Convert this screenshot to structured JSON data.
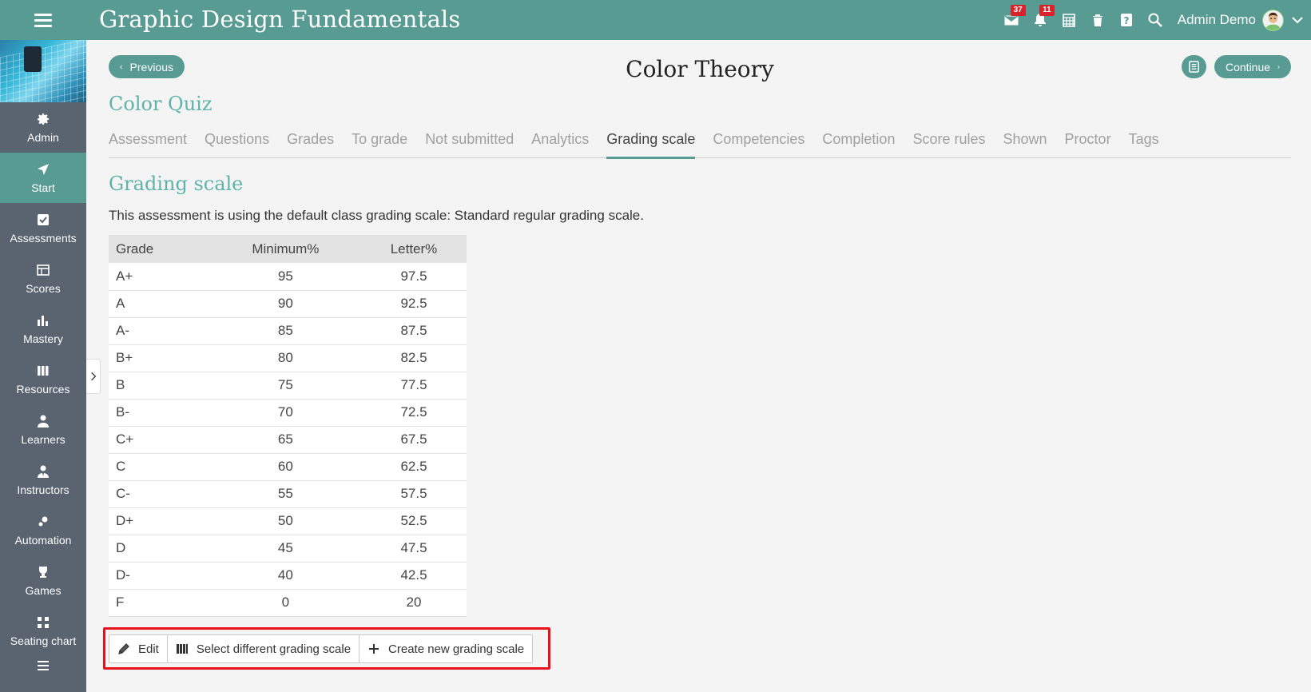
{
  "app": {
    "title": "Graphic Design Fundamentals",
    "accent": "#579b93"
  },
  "topbar": {
    "messages_badge": "37",
    "notifications_badge": "11",
    "user_name": "Admin Demo",
    "icons": [
      "mail-icon",
      "bell-icon",
      "calendar-icon",
      "trash-icon",
      "help-icon",
      "search-icon"
    ]
  },
  "sidebar": {
    "items": [
      {
        "label": "Admin",
        "icon": "gear-icon"
      },
      {
        "label": "Start",
        "icon": "navigate-icon",
        "active": true
      },
      {
        "label": "Assessments",
        "icon": "checkbox-icon"
      },
      {
        "label": "Scores",
        "icon": "table-icon"
      },
      {
        "label": "Mastery",
        "icon": "bar-chart-icon"
      },
      {
        "label": "Resources",
        "icon": "books-icon"
      },
      {
        "label": "Learners",
        "icon": "person-icon"
      },
      {
        "label": "Instructors",
        "icon": "instructor-icon"
      },
      {
        "label": "Automation",
        "icon": "gears-icon"
      },
      {
        "label": "Games",
        "icon": "trophy-icon"
      },
      {
        "label": "Seating chart",
        "icon": "seating-icon"
      }
    ]
  },
  "nav": {
    "previous_label": "Previous",
    "continue_label": "Continue",
    "page_title": "Color Theory"
  },
  "quiz": {
    "title": "Color Quiz"
  },
  "tabs": [
    {
      "label": "Assessment"
    },
    {
      "label": "Questions"
    },
    {
      "label": "Grades"
    },
    {
      "label": "To grade"
    },
    {
      "label": "Not submitted"
    },
    {
      "label": "Analytics"
    },
    {
      "label": "Grading scale",
      "active": true
    },
    {
      "label": "Competencies"
    },
    {
      "label": "Completion"
    },
    {
      "label": "Score rules"
    },
    {
      "label": "Shown"
    },
    {
      "label": "Proctor"
    },
    {
      "label": "Tags"
    }
  ],
  "grading": {
    "section_title": "Grading scale",
    "description": "This assessment is using the default class grading scale: Standard regular grading scale.",
    "columns": [
      "Grade",
      "Minimum%",
      "Letter%"
    ],
    "rows": [
      [
        "A+",
        "95",
        "97.5"
      ],
      [
        "A",
        "90",
        "92.5"
      ],
      [
        "A-",
        "85",
        "87.5"
      ],
      [
        "B+",
        "80",
        "82.5"
      ],
      [
        "B",
        "75",
        "77.5"
      ],
      [
        "B-",
        "70",
        "72.5"
      ],
      [
        "C+",
        "65",
        "67.5"
      ],
      [
        "C",
        "60",
        "62.5"
      ],
      [
        "C-",
        "55",
        "57.5"
      ],
      [
        "D+",
        "50",
        "52.5"
      ],
      [
        "D",
        "45",
        "47.5"
      ],
      [
        "D-",
        "40",
        "42.5"
      ],
      [
        "F",
        "0",
        "20"
      ]
    ]
  },
  "actions": {
    "edit_label": "Edit",
    "select_label": "Select different grading scale",
    "create_label": "Create new grading scale"
  }
}
